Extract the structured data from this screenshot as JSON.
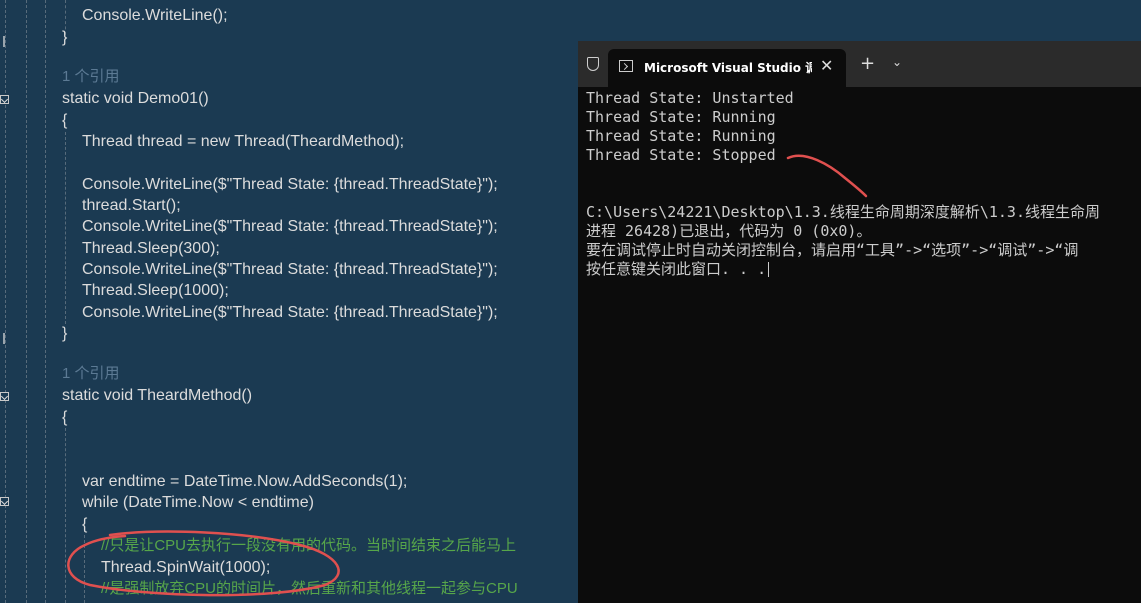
{
  "editor": {
    "lines": [
      {
        "text": "Console.WriteLine();"
      },
      {
        "text": "}"
      },
      {
        "text": "1 个引用"
      },
      {
        "text": "static void Demo01()"
      },
      {
        "text": "{"
      },
      {
        "text": "Thread thread = new Thread(TheardMethod);"
      },
      {
        "text": "Console.WriteLine($\"Thread State: {thread.ThreadState}\");"
      },
      {
        "text": "thread.Start();"
      },
      {
        "text": "Console.WriteLine($\"Thread State: {thread.ThreadState}\");"
      },
      {
        "text": "Thread.Sleep(300);"
      },
      {
        "text": "Console.WriteLine($\"Thread State: {thread.ThreadState}\");"
      },
      {
        "text": "Thread.Sleep(1000);"
      },
      {
        "text": "Console.WriteLine($\"Thread State: {thread.ThreadState}\");"
      },
      {
        "text": "}"
      },
      {
        "text": "1 个引用"
      },
      {
        "text": "static void TheardMethod()"
      },
      {
        "text": "{"
      },
      {
        "text": "var endtime = DateTime.Now.AddSeconds(1);"
      },
      {
        "text": "while (DateTime.Now < endtime)"
      },
      {
        "text": "{"
      },
      {
        "text": "//只是让CPU去执行一段没有用的代码。当时间结束之后能马上"
      },
      {
        "text": "Thread.SpinWait(1000);"
      },
      {
        "text": "//是强制放弃CPU的时间片，然后重新和其他线程一起参与CPU"
      }
    ]
  },
  "console": {
    "tab_title": "Microsoft Visual Studio 调试控",
    "tab_close": "✕",
    "new_tab": "+",
    "dropdown": "⌄",
    "output": [
      "Thread State: Unstarted",
      "Thread State: Running",
      "Thread State: Running",
      "Thread State: Stopped",
      "",
      "C:\\Users\\24221\\Desktop\\1.3.线程生命周期深度解析\\1.3.线程生命周",
      "进程 26428)已退出，代码为 0 (0x0)。",
      "要在调试停止时自动关闭控制台，请启用“工具”->“选项”->“调试”->“调",
      "按任意键关闭此窗口. . ."
    ]
  }
}
